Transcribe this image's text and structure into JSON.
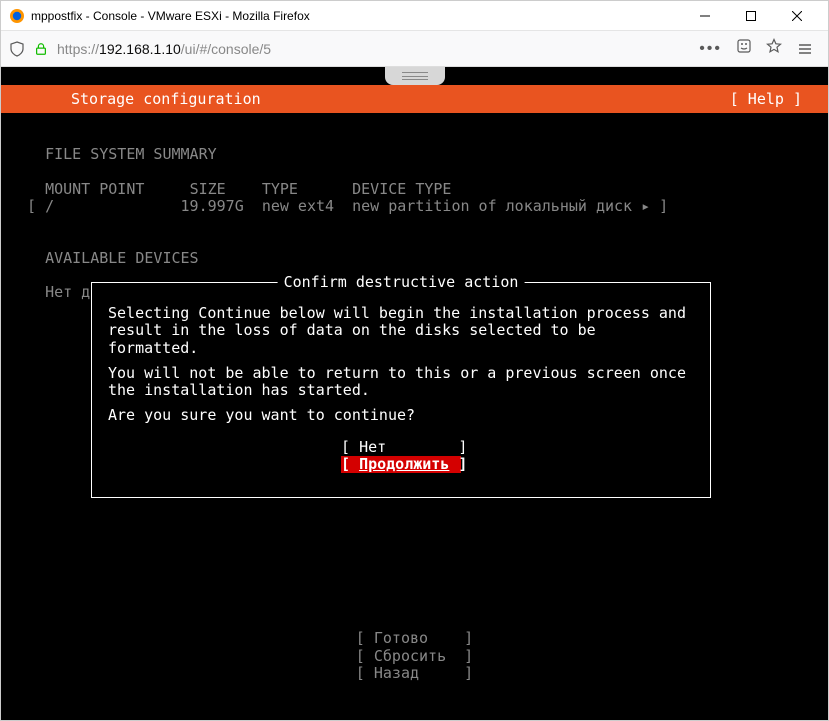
{
  "window": {
    "title": "mppostfix - Console - VMware ESXi - Mozilla Firefox"
  },
  "addressbar": {
    "scheme": "https://",
    "host": "192.168.1.10",
    "path": "/ui/#/console/5"
  },
  "header": {
    "title": "Storage configuration",
    "help": "[ Help ]"
  },
  "summary": {
    "heading": "FILE SYSTEM SUMMARY",
    "cols": {
      "mount": "MOUNT POINT",
      "size": "SIZE",
      "type": "TYPE",
      "device": "DEVICE TYPE"
    },
    "row": {
      "mount": "/",
      "size": "19.997G",
      "type": "new ext4",
      "device": "new partition of локальный диск ▸"
    }
  },
  "devices": {
    "heading": "AVAILABLE DEVICES",
    "none": "Нет доступных устройств"
  },
  "dialog": {
    "title": "Confirm destructive action",
    "p1": "Selecting Continue below will begin the installation process and result in the loss of data on the disks selected to be formatted.",
    "p2": "You will not be able to return to this or a previous screen once the installation has started.",
    "p3": "Are you sure you want to continue?",
    "no": "Нет",
    "yes": "Продолжить"
  },
  "footer": {
    "done": "Готово",
    "reset": "Сбросить",
    "back": "Назад"
  }
}
